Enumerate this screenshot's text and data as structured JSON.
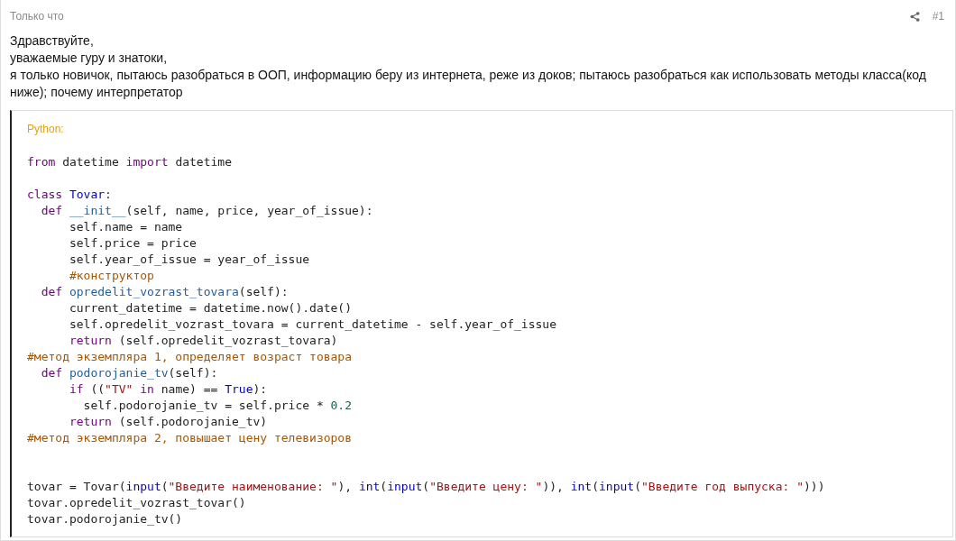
{
  "post": {
    "time": "Только что",
    "number": "#1",
    "paragraphs": [
      "Здравствуйте,",
      "уважаемые гуру и знатоки,",
      "я только новичок, пытаюсь разобраться в ООП, информацию беру из интернета, реже из доков; пытаюсь разобраться как использовать методы класса(код ниже); почему интерпретатор"
    ]
  },
  "code_block": {
    "language": "Python:",
    "lines": [
      {
        "kind": "blank"
      },
      {
        "kind": "code",
        "tokens": [
          {
            "kind": "keyword",
            "text": "from"
          },
          {
            "kind": "plain",
            "text": " datetime "
          },
          {
            "kind": "keyword",
            "text": "import"
          },
          {
            "kind": "plain",
            "text": " datetime"
          }
        ]
      },
      {
        "kind": "blank"
      },
      {
        "kind": "code",
        "tokens": [
          {
            "kind": "keyword",
            "text": "class"
          },
          {
            "kind": "builtin",
            "text": " Tovar"
          },
          {
            "kind": "plain",
            "text": ":"
          }
        ]
      },
      {
        "kind": "code",
        "tokens": [
          {
            "kind": "keyword",
            "text": "  def"
          },
          {
            "kind": "defname",
            "text": " __init__"
          },
          {
            "kind": "plain",
            "text": "(self, name, price, year_of_issue):"
          }
        ]
      },
      {
        "kind": "code",
        "tokens": [
          {
            "kind": "plain",
            "text": "      self.name = name"
          }
        ]
      },
      {
        "kind": "code",
        "tokens": [
          {
            "kind": "plain",
            "text": "      self.price = price"
          }
        ]
      },
      {
        "kind": "code",
        "tokens": [
          {
            "kind": "plain",
            "text": "      self.year_of_issue = year_of_issue"
          }
        ]
      },
      {
        "kind": "code",
        "tokens": [
          {
            "kind": "comment",
            "text": "      #конструктор"
          }
        ]
      },
      {
        "kind": "code",
        "tokens": [
          {
            "kind": "keyword",
            "text": "  def"
          },
          {
            "kind": "defname",
            "text": " opredelit_vozrast_tovara"
          },
          {
            "kind": "plain",
            "text": "(self):"
          }
        ]
      },
      {
        "kind": "code",
        "tokens": [
          {
            "kind": "plain",
            "text": "      current_datetime = datetime.now().date()"
          }
        ]
      },
      {
        "kind": "code",
        "tokens": [
          {
            "kind": "plain",
            "text": "      self.opredelit_vozrast_tovara = current_datetime - self.year_of_issue"
          }
        ]
      },
      {
        "kind": "code",
        "tokens": [
          {
            "kind": "keyword",
            "text": "      return"
          },
          {
            "kind": "plain",
            "text": " (self.opredelit_vozrast_tovara)"
          }
        ]
      },
      {
        "kind": "code",
        "tokens": [
          {
            "kind": "comment",
            "text": "#метод экземпляра 1, определяет возраст товара"
          }
        ]
      },
      {
        "kind": "code",
        "tokens": [
          {
            "kind": "keyword",
            "text": "  def"
          },
          {
            "kind": "defname",
            "text": " podorojanie_tv"
          },
          {
            "kind": "plain",
            "text": "(self):"
          }
        ]
      },
      {
        "kind": "code",
        "tokens": [
          {
            "kind": "keyword",
            "text": "      if"
          },
          {
            "kind": "plain",
            "text": " (("
          },
          {
            "kind": "string",
            "text": "\"TV\""
          },
          {
            "kind": "keyword",
            "text": " in"
          },
          {
            "kind": "plain",
            "text": " name) == "
          },
          {
            "kind": "builtin",
            "text": "True"
          },
          {
            "kind": "plain",
            "text": "):"
          }
        ]
      },
      {
        "kind": "code",
        "tokens": [
          {
            "kind": "plain",
            "text": "        self.podorojanie_tv = self.price * "
          },
          {
            "kind": "number",
            "text": "0.2"
          }
        ]
      },
      {
        "kind": "code",
        "tokens": [
          {
            "kind": "keyword",
            "text": "      return"
          },
          {
            "kind": "plain",
            "text": " (self.podorojanie_tv)"
          }
        ]
      },
      {
        "kind": "code",
        "tokens": [
          {
            "kind": "comment",
            "text": "#метод экземпляра 2, повышает цену телевизоров"
          }
        ]
      },
      {
        "kind": "blank"
      },
      {
        "kind": "blank"
      },
      {
        "kind": "code",
        "tokens": [
          {
            "kind": "plain",
            "text": "tovar = Tovar("
          },
          {
            "kind": "builtin",
            "text": "input"
          },
          {
            "kind": "plain",
            "text": "("
          },
          {
            "kind": "string",
            "text": "\"Введите наименование: \""
          },
          {
            "kind": "plain",
            "text": "), "
          },
          {
            "kind": "builtin",
            "text": "int"
          },
          {
            "kind": "plain",
            "text": "("
          },
          {
            "kind": "builtin",
            "text": "input"
          },
          {
            "kind": "plain",
            "text": "("
          },
          {
            "kind": "string",
            "text": "\"Введите цену: \""
          },
          {
            "kind": "plain",
            "text": ")), "
          },
          {
            "kind": "builtin",
            "text": "int"
          },
          {
            "kind": "plain",
            "text": "("
          },
          {
            "kind": "builtin",
            "text": "input"
          },
          {
            "kind": "plain",
            "text": "("
          },
          {
            "kind": "string",
            "text": "\"Введите год выпуска: \""
          },
          {
            "kind": "plain",
            "text": ")))"
          }
        ]
      },
      {
        "kind": "code",
        "tokens": [
          {
            "kind": "plain",
            "text": "tovar.opredelit_vozrast_tovar()"
          }
        ]
      },
      {
        "kind": "code",
        "tokens": [
          {
            "kind": "plain",
            "text": "tovar.podorojanie_tv()"
          }
        ]
      }
    ]
  }
}
